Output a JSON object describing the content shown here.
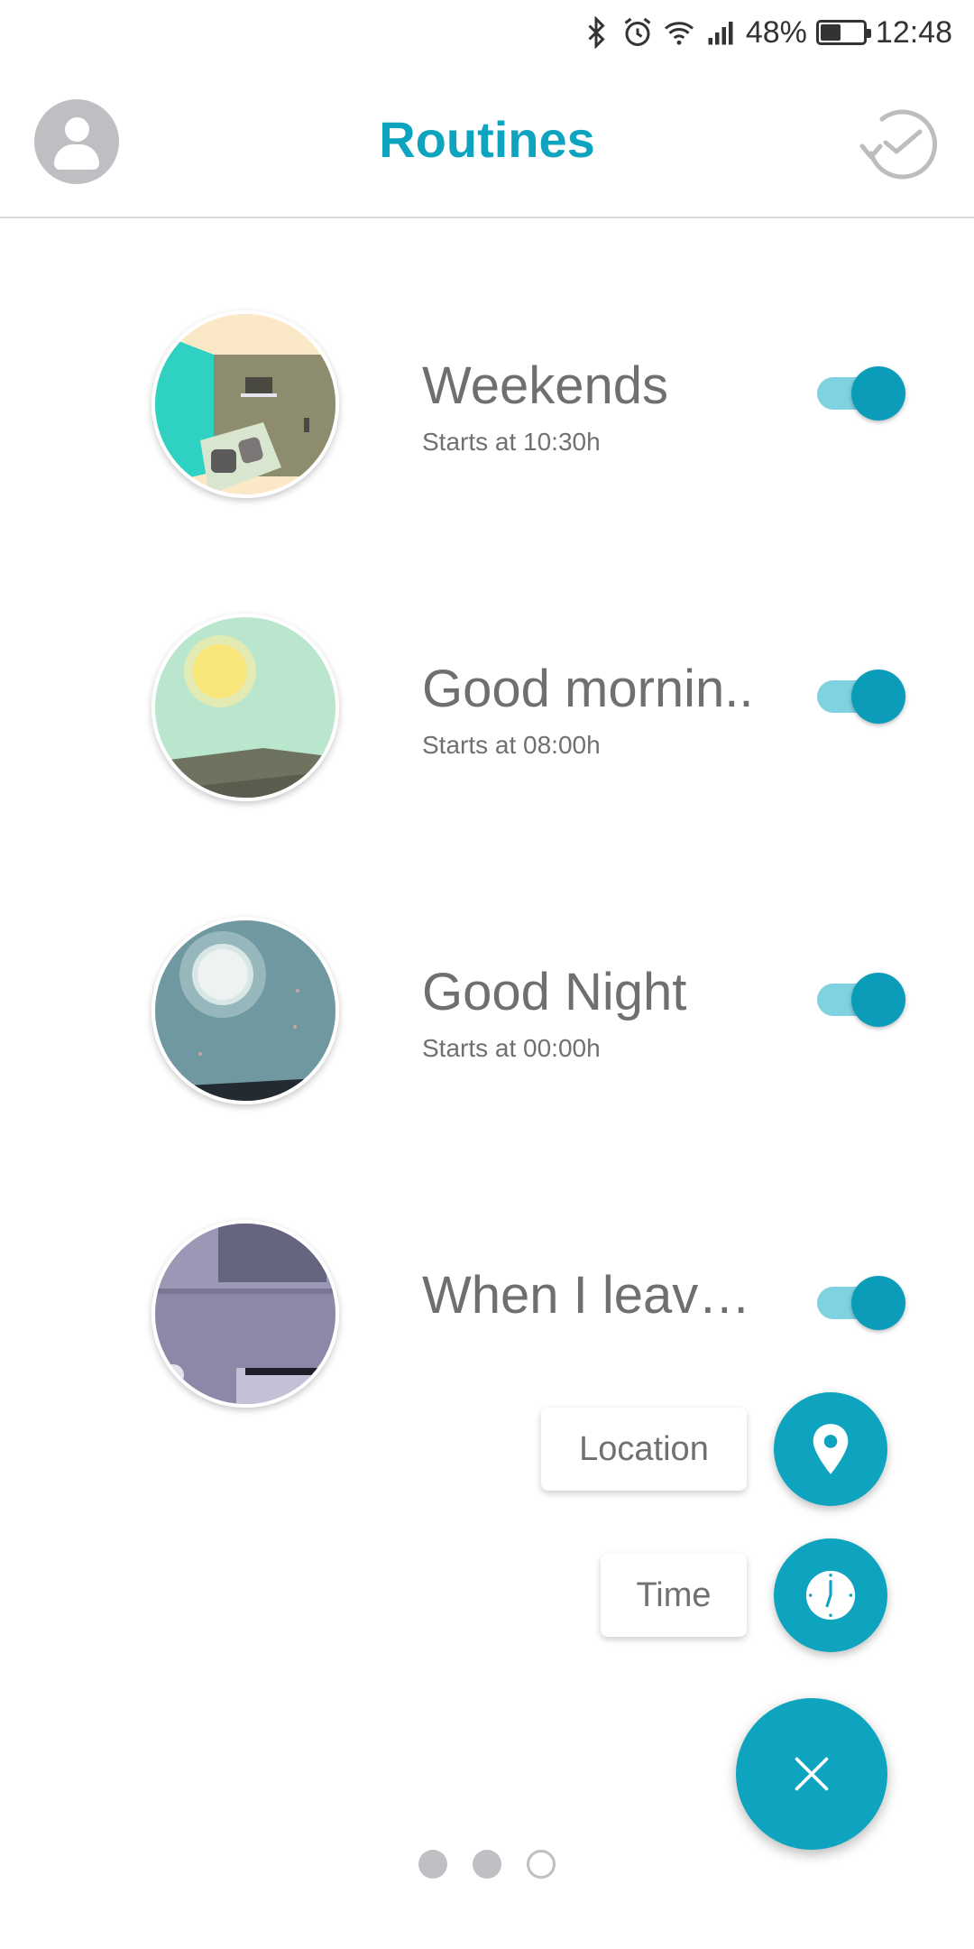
{
  "status_bar": {
    "battery_percent": "48%",
    "battery_level": 0.48,
    "time": "12:48",
    "icons": [
      "bluetooth-icon",
      "alarm-icon",
      "wifi-icon",
      "signal-icon",
      "battery-icon"
    ]
  },
  "header": {
    "title": "Routines",
    "left_icon": "avatar-icon",
    "right_icon": "history-clock-icon"
  },
  "colors": {
    "accent": "#0ea3be",
    "toggle_track": "#7fd2df",
    "toggle_knob": "#0b9cba"
  },
  "routines": [
    {
      "name": "Weekends",
      "subtitle": "Starts at 10:30h",
      "enabled": true,
      "image": "living-room"
    },
    {
      "name": "Good mornin..",
      "subtitle": "Starts at 08:00h",
      "enabled": true,
      "image": "sunrise"
    },
    {
      "name": "Good Night",
      "subtitle": "Starts at 00:00h",
      "enabled": true,
      "image": "moon-night"
    },
    {
      "name": "When I leave...",
      "subtitle": "",
      "enabled": true,
      "image": "bedroom"
    }
  ],
  "fab_menu": {
    "location_label": "Location",
    "time_label": "Time",
    "location_icon": "location-pin-icon",
    "time_icon": "clock-icon",
    "main_icon": "close-icon"
  },
  "pagination": {
    "total": 3,
    "active_index": 2
  }
}
